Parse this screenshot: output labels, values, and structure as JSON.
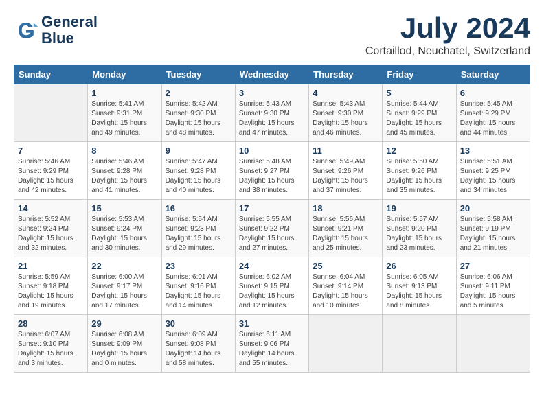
{
  "header": {
    "logo_line1": "General",
    "logo_line2": "Blue",
    "month_year": "July 2024",
    "location": "Cortaillod, Neuchatel, Switzerland"
  },
  "days_of_week": [
    "Sunday",
    "Monday",
    "Tuesday",
    "Wednesday",
    "Thursday",
    "Friday",
    "Saturday"
  ],
  "weeks": [
    [
      {
        "day": "",
        "info": ""
      },
      {
        "day": "1",
        "info": "Sunrise: 5:41 AM\nSunset: 9:31 PM\nDaylight: 15 hours\nand 49 minutes."
      },
      {
        "day": "2",
        "info": "Sunrise: 5:42 AM\nSunset: 9:30 PM\nDaylight: 15 hours\nand 48 minutes."
      },
      {
        "day": "3",
        "info": "Sunrise: 5:43 AM\nSunset: 9:30 PM\nDaylight: 15 hours\nand 47 minutes."
      },
      {
        "day": "4",
        "info": "Sunrise: 5:43 AM\nSunset: 9:30 PM\nDaylight: 15 hours\nand 46 minutes."
      },
      {
        "day": "5",
        "info": "Sunrise: 5:44 AM\nSunset: 9:29 PM\nDaylight: 15 hours\nand 45 minutes."
      },
      {
        "day": "6",
        "info": "Sunrise: 5:45 AM\nSunset: 9:29 PM\nDaylight: 15 hours\nand 44 minutes."
      }
    ],
    [
      {
        "day": "7",
        "info": "Sunrise: 5:46 AM\nSunset: 9:29 PM\nDaylight: 15 hours\nand 42 minutes."
      },
      {
        "day": "8",
        "info": "Sunrise: 5:46 AM\nSunset: 9:28 PM\nDaylight: 15 hours\nand 41 minutes."
      },
      {
        "day": "9",
        "info": "Sunrise: 5:47 AM\nSunset: 9:28 PM\nDaylight: 15 hours\nand 40 minutes."
      },
      {
        "day": "10",
        "info": "Sunrise: 5:48 AM\nSunset: 9:27 PM\nDaylight: 15 hours\nand 38 minutes."
      },
      {
        "day": "11",
        "info": "Sunrise: 5:49 AM\nSunset: 9:26 PM\nDaylight: 15 hours\nand 37 minutes."
      },
      {
        "day": "12",
        "info": "Sunrise: 5:50 AM\nSunset: 9:26 PM\nDaylight: 15 hours\nand 35 minutes."
      },
      {
        "day": "13",
        "info": "Sunrise: 5:51 AM\nSunset: 9:25 PM\nDaylight: 15 hours\nand 34 minutes."
      }
    ],
    [
      {
        "day": "14",
        "info": "Sunrise: 5:52 AM\nSunset: 9:24 PM\nDaylight: 15 hours\nand 32 minutes."
      },
      {
        "day": "15",
        "info": "Sunrise: 5:53 AM\nSunset: 9:24 PM\nDaylight: 15 hours\nand 30 minutes."
      },
      {
        "day": "16",
        "info": "Sunrise: 5:54 AM\nSunset: 9:23 PM\nDaylight: 15 hours\nand 29 minutes."
      },
      {
        "day": "17",
        "info": "Sunrise: 5:55 AM\nSunset: 9:22 PM\nDaylight: 15 hours\nand 27 minutes."
      },
      {
        "day": "18",
        "info": "Sunrise: 5:56 AM\nSunset: 9:21 PM\nDaylight: 15 hours\nand 25 minutes."
      },
      {
        "day": "19",
        "info": "Sunrise: 5:57 AM\nSunset: 9:20 PM\nDaylight: 15 hours\nand 23 minutes."
      },
      {
        "day": "20",
        "info": "Sunrise: 5:58 AM\nSunset: 9:19 PM\nDaylight: 15 hours\nand 21 minutes."
      }
    ],
    [
      {
        "day": "21",
        "info": "Sunrise: 5:59 AM\nSunset: 9:18 PM\nDaylight: 15 hours\nand 19 minutes."
      },
      {
        "day": "22",
        "info": "Sunrise: 6:00 AM\nSunset: 9:17 PM\nDaylight: 15 hours\nand 17 minutes."
      },
      {
        "day": "23",
        "info": "Sunrise: 6:01 AM\nSunset: 9:16 PM\nDaylight: 15 hours\nand 14 minutes."
      },
      {
        "day": "24",
        "info": "Sunrise: 6:02 AM\nSunset: 9:15 PM\nDaylight: 15 hours\nand 12 minutes."
      },
      {
        "day": "25",
        "info": "Sunrise: 6:04 AM\nSunset: 9:14 PM\nDaylight: 15 hours\nand 10 minutes."
      },
      {
        "day": "26",
        "info": "Sunrise: 6:05 AM\nSunset: 9:13 PM\nDaylight: 15 hours\nand 8 minutes."
      },
      {
        "day": "27",
        "info": "Sunrise: 6:06 AM\nSunset: 9:11 PM\nDaylight: 15 hours\nand 5 minutes."
      }
    ],
    [
      {
        "day": "28",
        "info": "Sunrise: 6:07 AM\nSunset: 9:10 PM\nDaylight: 15 hours\nand 3 minutes."
      },
      {
        "day": "29",
        "info": "Sunrise: 6:08 AM\nSunset: 9:09 PM\nDaylight: 15 hours\nand 0 minutes."
      },
      {
        "day": "30",
        "info": "Sunrise: 6:09 AM\nSunset: 9:08 PM\nDaylight: 14 hours\nand 58 minutes."
      },
      {
        "day": "31",
        "info": "Sunrise: 6:11 AM\nSunset: 9:06 PM\nDaylight: 14 hours\nand 55 minutes."
      },
      {
        "day": "",
        "info": ""
      },
      {
        "day": "",
        "info": ""
      },
      {
        "day": "",
        "info": ""
      }
    ]
  ]
}
